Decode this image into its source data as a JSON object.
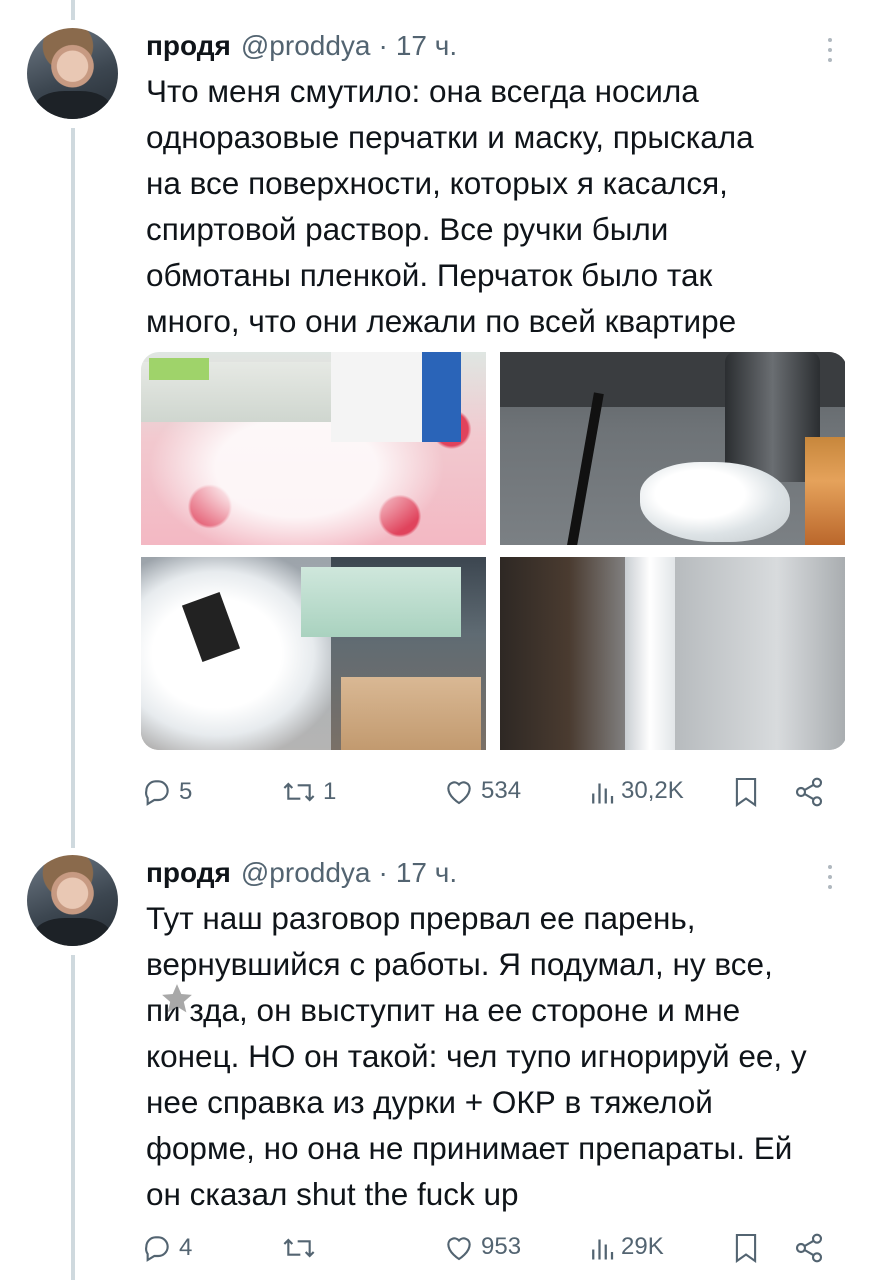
{
  "tweets": [
    {
      "author": "продя",
      "handle": "@proddya",
      "separator": "·",
      "time": "17 ч.",
      "text_lines": [
        "Что меня смутило: она всегда носила",
        "одноразовые перчатки и маску, прыскала",
        "на все поверхности, которых я касался,",
        "спиртовой раствор. Все ручки были",
        "обмотаны пленкой. Перчаток было так",
        "много, что они лежали по всей квартире"
      ],
      "stats": {
        "replies": "5",
        "retweets": "1",
        "likes": "534",
        "views": "30,2K"
      }
    },
    {
      "author": "продя",
      "handle": "@proddya",
      "separator": "·",
      "time": "17 ч.",
      "text_lines": [
        "Тут наш разговор прервал ее парень,",
        "вернувшийся с работы. Я подумал, ну все,",
        "пи   зда, он выступит на ее стороне и мне",
        "конец. НО он такой: чел тупо игнорируй ее, у",
        "нее справка из дурки + ОКР в тяжелой",
        "форме, но она не принимает препараты. Ей",
        "он сказал shut the fuck up"
      ],
      "stats": {
        "replies": "4",
        "retweets": "",
        "likes": "953",
        "views": "29K"
      }
    }
  ],
  "icons": [
    "reply-icon",
    "retweet-icon",
    "like-icon",
    "views-icon",
    "bookmark-icon",
    "share-icon",
    "more-icon",
    "censor-star-icon"
  ],
  "colors": {
    "text": "#0f1419",
    "secondary": "#536471",
    "thread_line": "#cfd9de"
  }
}
